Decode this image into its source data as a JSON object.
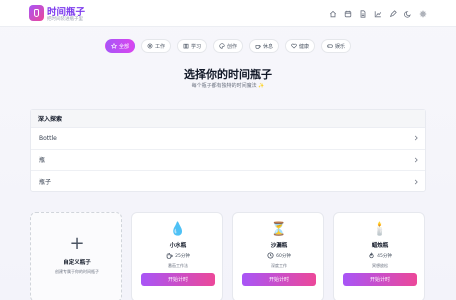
{
  "app": {
    "title": "时间瓶子",
    "subtitle": "把时间装进瓶子里"
  },
  "header_icons": [
    "home-icon",
    "calendar-icon",
    "file-icon",
    "chart-icon",
    "pen-icon",
    "moon-icon",
    "settings-icon"
  ],
  "tabs": [
    {
      "label": "全部",
      "icon": "star-icon",
      "active": true
    },
    {
      "label": "工作",
      "icon": "briefcase-icon",
      "active": false
    },
    {
      "label": "学习",
      "icon": "book-icon",
      "active": false
    },
    {
      "label": "创作",
      "icon": "palette-icon",
      "active": false
    },
    {
      "label": "休息",
      "icon": "coffee-icon",
      "active": false
    },
    {
      "label": "健康",
      "icon": "heart-icon",
      "active": false
    },
    {
      "label": "娱乐",
      "icon": "gamepad-icon",
      "active": false
    }
  ],
  "hero": {
    "title": "选择你的时间瓶子",
    "subtitle": "每个瓶子都有独特的时间魔法 ✨"
  },
  "explore": {
    "heading": "深入探索",
    "items": [
      "Bottle",
      "瓶",
      "瓶子"
    ]
  },
  "custom_card": {
    "name": "自定义瓶子",
    "desc": "创建专属于你的时间瓶子"
  },
  "cards": [
    {
      "emoji": "💧",
      "name": "小水瓶",
      "duration": "25分钟",
      "desc": "番茄工作法",
      "button": "开始计时"
    },
    {
      "emoji": "⏳",
      "name": "沙漏瓶",
      "duration": "60分钟",
      "desc": "深度工作",
      "button": "开始计时"
    },
    {
      "emoji": "🕯️",
      "name": "蜡烛瓶",
      "duration": "45分钟",
      "desc": "冥想放松",
      "button": "开始计时"
    }
  ],
  "colors": {
    "accent": "#a855f7",
    "accent2": "#ec4899"
  }
}
